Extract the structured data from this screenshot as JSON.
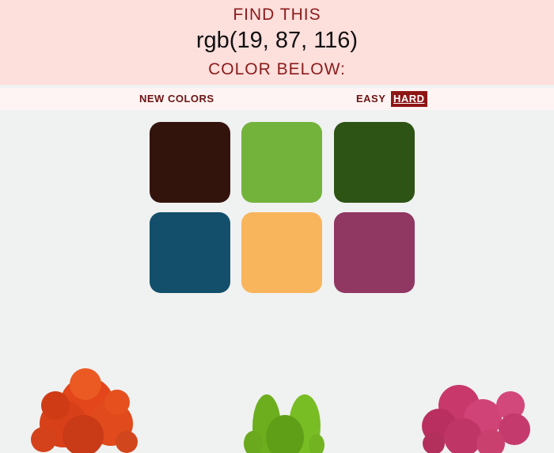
{
  "header": {
    "line1": "FIND THIS",
    "target_rgb": "rgb(19, 87, 116)",
    "line3": "COLOR BELOW:",
    "background_color": "#fddfdc"
  },
  "controls": {
    "new_colors_label": "NEW COLORS",
    "easy_label": "EASY",
    "hard_label": "HARD",
    "active_mode": "HARD"
  },
  "squares": [
    {
      "color": "#33140d"
    },
    {
      "color": "#73b33c"
    },
    {
      "color": "#2d5414"
    },
    {
      "color": "#134f6b"
    },
    {
      "color": "#f8b55b"
    },
    {
      "color": "#903762"
    }
  ],
  "decoration": {
    "plants": [
      "orange-cactus",
      "green-cactus",
      "pink-cactus"
    ]
  }
}
